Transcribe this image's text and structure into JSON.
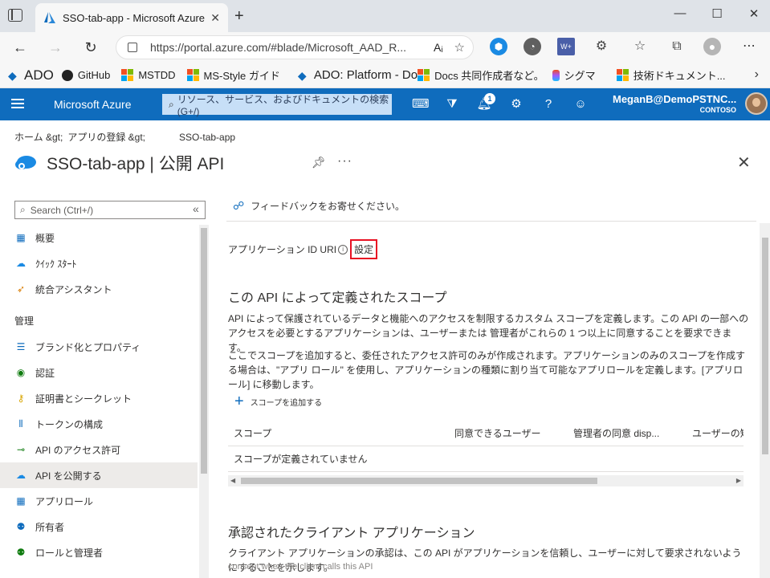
{
  "browser": {
    "tab_title": "SSO-tab-app -   Microsoft Azure",
    "url": "https://portal.azure.com/#blade/Microsoft_AAD_R...",
    "read_aloud": "Aᵢ",
    "bookmarks": [
      "ADO",
      "GitHub",
      "MSTDD",
      "MS-Style ガイド",
      "ADO: Platform - Do",
      "Docs 共同作成者など。",
      "シグマ",
      "技術ドキュメント..."
    ]
  },
  "azure": {
    "brand": "Microsoft Azure",
    "search_placeholder": "リソース、サービス、およびドキュメントの検索 (G+/)",
    "notifications_count": "1",
    "user_name": "MeganB@DemoPSTNC...",
    "tenant": "CONTOSO"
  },
  "breadcrumb": {
    "home": "ホーム &gt;",
    "app_reg": "アプリの登録 &gt;",
    "app": "SSO-tab-app"
  },
  "page": {
    "title": "SSO-tab-app | 公開 API"
  },
  "nav": {
    "search_placeholder": "Search (Ctrl+/)",
    "items": [
      {
        "label": "概要",
        "icon": "overview-icon"
      },
      {
        "label": "ｸｲｯｸ ｽﾀｰﾄ",
        "icon": "quickstart-icon"
      },
      {
        "label": "統合アシスタント",
        "icon": "rocket-icon"
      }
    ],
    "group_manage": "管理",
    "manage_items": [
      {
        "label": "ブランド化とプロパティ",
        "icon": "branding-icon"
      },
      {
        "label": "認証",
        "icon": "authentication-icon"
      },
      {
        "label": "証明書とシークレット",
        "icon": "key-icon"
      },
      {
        "label": "トークンの構成",
        "icon": "token-icon"
      },
      {
        "label": "API のアクセス許可",
        "icon": "api-permissions-icon"
      },
      {
        "label": "API を公開する",
        "icon": "expose-api-icon"
      },
      {
        "label": "アプリロール",
        "icon": "app-roles-icon"
      },
      {
        "label": "所有者",
        "icon": "owners-icon"
      },
      {
        "label": "ロールと管理者",
        "icon": "roles-icon"
      }
    ]
  },
  "main": {
    "feedback": "フィードバックをお寄せください。",
    "app_id_uri_label": "アプリケーション ID URI",
    "set_link": "設定",
    "scopes_heading": "この API によって定義されたスコープ",
    "scopes_desc1": "API によって保護されているデータと機能へのアクセスを制限するカスタム スコープを定義します。この API の一部へのアクセスを必要とするアプリケーションは、ユーザーまたは 管理者がこれらの 1 つ以上に同意することを要求できます。",
    "scopes_desc2": "ここでスコープを追加すると、委任されたアクセス許可のみが作成されます。アプリケーションのみのスコープを作成する場合は、\"アプリ ロール\" を使用し、アプリケーションの種類に割り当て可能なアプリロールを定義します。[アプリロール] に移動します。",
    "add_scope": "スコープを追加する",
    "table_headers": [
      "スコープ",
      "同意できるユーザー",
      "管理者の同意 disp...",
      "ユーザーの短所"
    ],
    "empty_row": "スコープが定義されていません",
    "clients_heading": "承認されたクライアント アプリケーション",
    "clients_desc": "クライアント アプリケーションの承認は、この API がアプリケーションを信頼し、ユーザーに対して要求されないようにすることを示します。",
    "clients_cut": "consent when the client calls this API"
  }
}
